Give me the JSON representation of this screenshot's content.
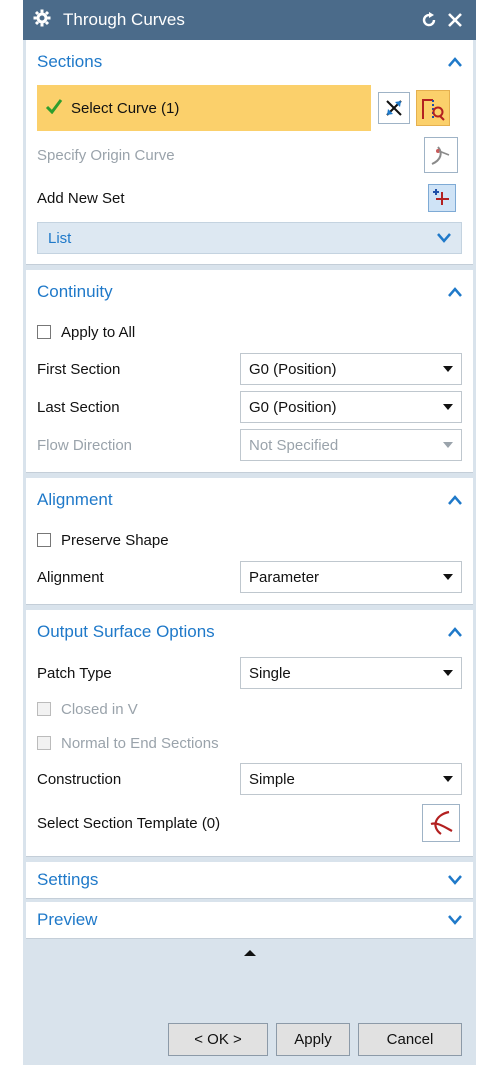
{
  "window": {
    "title": "Through Curves"
  },
  "sections_panel": {
    "header": "Sections",
    "select_curve": "Select Curve (1)",
    "origin_curve": "Specify Origin Curve",
    "add_new_set": "Add New Set",
    "list_label": "List"
  },
  "continuity": {
    "header": "Continuity",
    "apply_to_all": "Apply to All",
    "first_section_label": "First Section",
    "first_section_value": "G0 (Position)",
    "last_section_label": "Last Section",
    "last_section_value": "G0 (Position)",
    "flow_direction_label": "Flow Direction",
    "flow_direction_value": "Not Specified"
  },
  "alignment": {
    "header": "Alignment",
    "preserve_shape": "Preserve Shape",
    "alignment_label": "Alignment",
    "alignment_value": "Parameter"
  },
  "output": {
    "header": "Output Surface Options",
    "patch_type_label": "Patch Type",
    "patch_type_value": "Single",
    "closed_in_v": "Closed in V",
    "normal_to_end": "Normal to End Sections",
    "construction_label": "Construction",
    "construction_value": "Simple",
    "section_template": "Select Section Template (0)"
  },
  "settings": {
    "header": "Settings"
  },
  "preview": {
    "header": "Preview"
  },
  "buttons": {
    "ok": "< OK >",
    "apply": "Apply",
    "cancel": "Cancel"
  },
  "colors": {
    "title_bar": "#4b6b8a",
    "accent": "#1f79c9",
    "selection": "#fbd06b"
  },
  "icons": {
    "title": "gear-icon",
    "reset": "reset-icon",
    "close": "close-icon",
    "check": "check-icon",
    "reverse": "reverse-direction-icon",
    "curve": "curve-select-icon",
    "origin": "origin-curve-icon",
    "add": "add-set-icon",
    "template": "section-template-icon"
  }
}
